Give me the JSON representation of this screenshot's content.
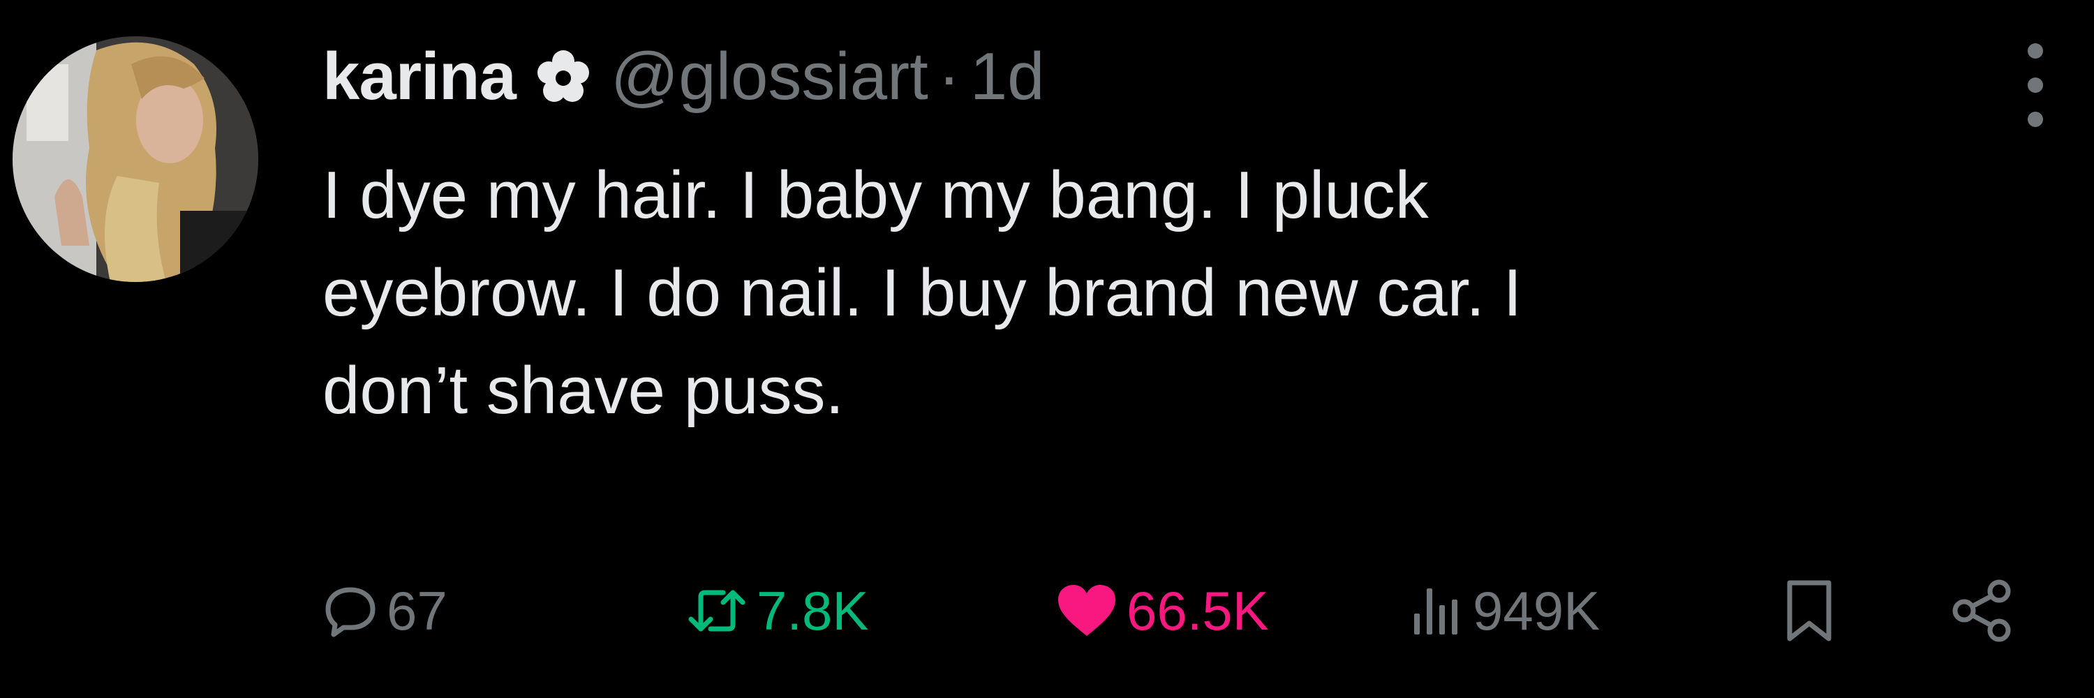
{
  "author": {
    "display_name": "karina",
    "badge_icon": "flower-icon",
    "handle": "@glossiart",
    "separator": "·",
    "time": "1d"
  },
  "tweet": {
    "lines": [
      "I dye my hair. I baby my bang. I pluck",
      "eyebrow. I do nail. I buy brand new car. I",
      "don’t shave puss."
    ]
  },
  "actions": {
    "reply_count": "67",
    "repost_count": "7.8K",
    "like_count": "66.5K",
    "view_count": "949K"
  },
  "colors": {
    "background": "#000000",
    "text": "#e7e9ea",
    "muted": "#71767b",
    "repost_green": "#00ba7c",
    "like_pink": "#f91880"
  },
  "icons": {
    "reply": "speech-bubble-icon",
    "repost": "repost-arrows-icon",
    "like": "heart-icon",
    "views": "bar-chart-icon",
    "bookmark": "bookmark-icon",
    "share": "share-icon",
    "more": "more-vertical-icon"
  }
}
